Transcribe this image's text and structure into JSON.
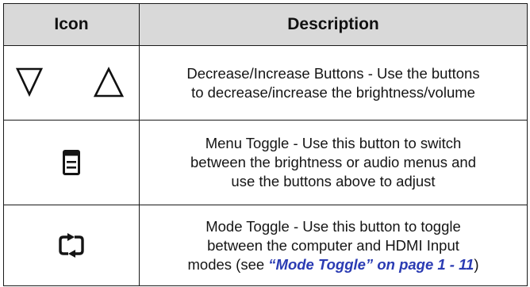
{
  "table": {
    "headers": {
      "icon": "Icon",
      "description": "Description"
    },
    "rows": [
      {
        "icons": [
          "decrease-triangle-icon",
          "increase-triangle-icon"
        ],
        "lines": [
          "Decrease/Increase Buttons - Use the buttons",
          "to decrease/increase the brightness/volume"
        ]
      },
      {
        "icons": [
          "menu-toggle-icon"
        ],
        "lines": [
          "Menu Toggle - Use this button to switch",
          "between the brightness or audio menus and",
          "use the buttons above to adjust"
        ]
      },
      {
        "icons": [
          "mode-toggle-icon"
        ],
        "lines": [
          "Mode Toggle - Use this button to toggle",
          "between the computer and HDMI Input"
        ],
        "line3_prefix": "modes (see ",
        "link_text": "“Mode Toggle” on page 1 - 11",
        "line3_suffix": ")"
      }
    ]
  }
}
